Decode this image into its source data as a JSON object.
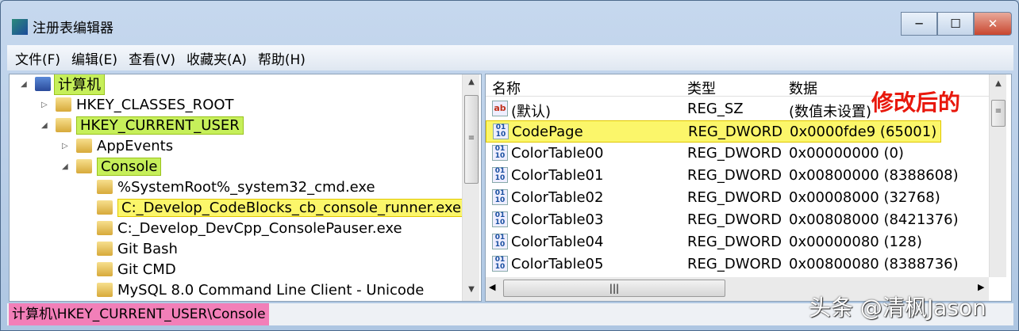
{
  "window": {
    "title": "注册表编辑器",
    "minimize": "─",
    "maximize": "☐",
    "close": "✕"
  },
  "menu": [
    "文件(F)",
    "编辑(E)",
    "查看(V)",
    "收藏夹(A)",
    "帮助(H)"
  ],
  "tree": [
    {
      "label": "计算机",
      "level": 0,
      "toggle": "◢",
      "highlight": "green"
    },
    {
      "label": "HKEY_CLASSES_ROOT",
      "level": 1,
      "toggle": "▷"
    },
    {
      "label": "HKEY_CURRENT_USER",
      "level": 1,
      "toggle": "◢",
      "highlight": "green"
    },
    {
      "label": "AppEvents",
      "level": 2,
      "toggle": "▷"
    },
    {
      "label": "Console",
      "level": 2,
      "toggle": "◢",
      "highlight": "green"
    },
    {
      "label": "%SystemRoot%_system32_cmd.exe",
      "level": 3,
      "toggle": ""
    },
    {
      "label": "C:_Develop_CodeBlocks_cb_console_runner.exe",
      "level": 3,
      "toggle": "",
      "highlight": "yellow"
    },
    {
      "label": "C:_Develop_DevCpp_ConsolePauser.exe",
      "level": 3,
      "toggle": ""
    },
    {
      "label": "Git Bash",
      "level": 3,
      "toggle": ""
    },
    {
      "label": "Git CMD",
      "level": 3,
      "toggle": ""
    },
    {
      "label": "MySQL 8.0 Command Line Client - Unicode",
      "level": 3,
      "toggle": ""
    }
  ],
  "values": {
    "headers": {
      "name": "名称",
      "type": "类型",
      "data": "数据"
    },
    "rows": [
      {
        "icon": "ab",
        "name": "(默认)",
        "type": "REG_SZ",
        "data": "(数值未设置)"
      },
      {
        "icon": "bin",
        "name": "CodePage",
        "type": "REG_DWORD",
        "data": "0x0000fde9 (65001)",
        "highlight": true
      },
      {
        "icon": "bin",
        "name": "ColorTable00",
        "type": "REG_DWORD",
        "data": "0x00000000 (0)"
      },
      {
        "icon": "bin",
        "name": "ColorTable01",
        "type": "REG_DWORD",
        "data": "0x00800000 (8388608)"
      },
      {
        "icon": "bin",
        "name": "ColorTable02",
        "type": "REG_DWORD",
        "data": "0x00008000 (32768)"
      },
      {
        "icon": "bin",
        "name": "ColorTable03",
        "type": "REG_DWORD",
        "data": "0x00808000 (8421376)"
      },
      {
        "icon": "bin",
        "name": "ColorTable04",
        "type": "REG_DWORD",
        "data": "0x00000080 (128)"
      },
      {
        "icon": "bin",
        "name": "ColorTable05",
        "type": "REG_DWORD",
        "data": "0x00800080 (8388736)"
      }
    ]
  },
  "annotation": "修改后的",
  "status_path": "计算机\\HKEY_CURRENT_USER\\Console",
  "watermark": "头条 @清枫Jason",
  "colors": {
    "green_highlight": "#c6ef5a",
    "yellow_highlight": "#fbf66a",
    "pink_highlight": "#f27fb8",
    "annotation_red": "#e8180c"
  }
}
